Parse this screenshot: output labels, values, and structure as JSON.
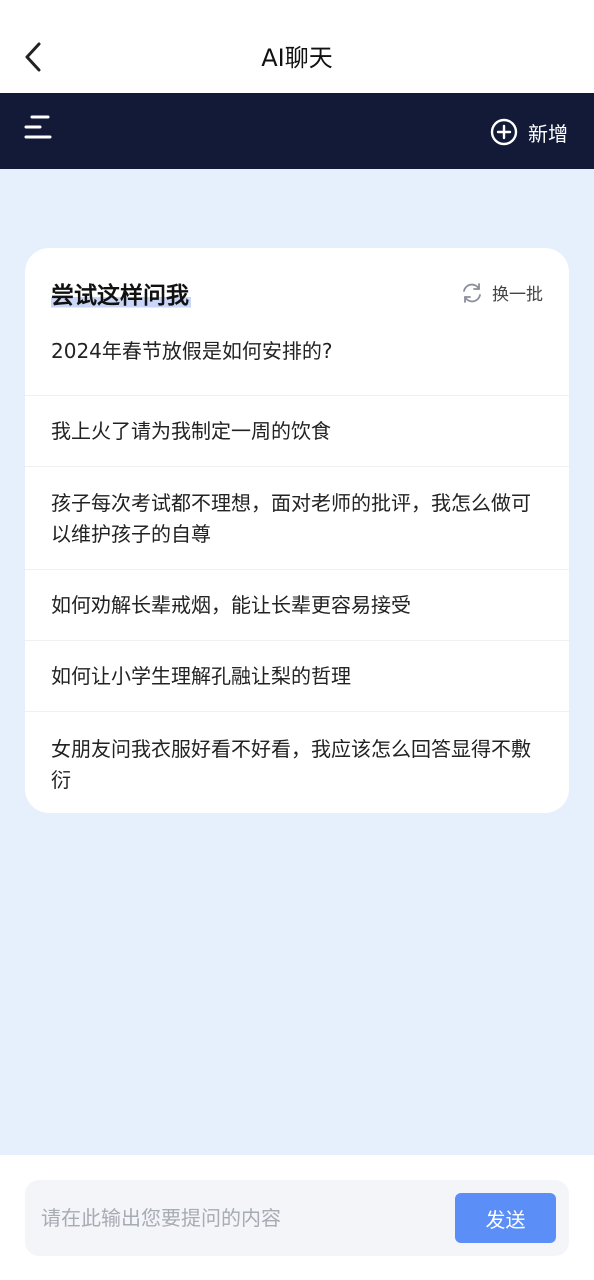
{
  "header": {
    "title": "AI聊天",
    "back_icon": "chevron-left-icon"
  },
  "navbar": {
    "menu_icon": "menu-icon",
    "new_label": "新增",
    "new_icon": "plus-circle-icon",
    "background": "#121a38"
  },
  "suggestions": {
    "title": "尝试这样问我",
    "refresh_label": "换一批",
    "refresh_icon": "refresh-icon",
    "items": [
      {
        "text": "2024年春节放假是如何安排的?"
      },
      {
        "text": "我上火了请为我制定一周的饮食"
      },
      {
        "text": "孩子每次考试都不理想，面对老师的批评，我怎么做可以维护孩子的自尊"
      },
      {
        "text": "如何劝解长辈戒烟，能让长辈更容易接受"
      },
      {
        "text": "如何让小学生理解孔融让梨的哲理"
      },
      {
        "text": "女朋友问我衣服好看不好看，我应该怎么回答显得不敷衍"
      }
    ]
  },
  "composer": {
    "placeholder": "请在此输出您要提问的内容",
    "value": "",
    "send_label": "发送",
    "accent": "#5b8ef6"
  }
}
